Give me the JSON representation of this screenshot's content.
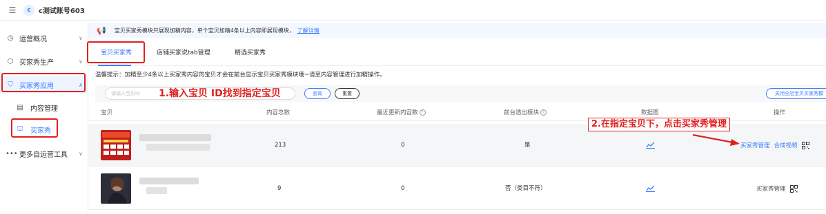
{
  "header": {
    "menu_icon": "menu-icon",
    "avatar_letter": "c",
    "account_name": "c测试账号603"
  },
  "sidebar": {
    "items": [
      {
        "icon": "clock-icon",
        "label": "运营概况",
        "chevron": "chevron-down-icon"
      },
      {
        "icon": "box-icon",
        "label": "买家秀生产",
        "chevron": "chevron-down-icon"
      },
      {
        "icon": "bag-icon",
        "label": "买家秀应用",
        "chevron": "chevron-up-icon"
      },
      {
        "icon": "document-icon",
        "label": "内容管理"
      },
      {
        "icon": "shop-icon",
        "label": "买家秀"
      },
      {
        "icon": "more-icon",
        "label": "更多自运营工具",
        "chevron": "chevron-down-icon"
      }
    ]
  },
  "notice": {
    "icon": "megaphone-icon",
    "text": "宝贝买家秀模块只展现加精内容，单个宝贝加精4条以上内容即展现模块，",
    "link": "了解详情"
  },
  "tabs": [
    {
      "label": "宝贝买家秀",
      "active": true
    },
    {
      "label": "店铺买家说tab管理",
      "active": false
    },
    {
      "label": "精选买家秀",
      "active": false
    }
  ],
  "tip": "温馨提示：加精至少4条以上买家秀内容的宝贝才会在前台显示宝贝买家秀模块哦~请至内容管理进行加精操作。",
  "filter": {
    "search_placeholder": "请输入宝贝id",
    "query_label": "查询",
    "reset_label": "重置",
    "close_all_label": "关闭全店宝贝买家秀模"
  },
  "annotations": {
    "step1": "1.输入宝贝 ID找到指定宝贝",
    "step2": "2.在指定宝贝下，点击买家秀管理"
  },
  "table": {
    "columns": [
      "宝贝",
      "内容总数",
      "最近更新内容数",
      "前台透出模块",
      "数据图",
      "操作"
    ],
    "rows": [
      {
        "total": "213",
        "recent": "0",
        "shown": "是",
        "chart_icon": "line-chart-icon",
        "actions": [
          "买家秀管理",
          "合成视频"
        ],
        "qr_icon": "qrcode-icon"
      },
      {
        "total": "9",
        "recent": "0",
        "shown": "否（类目不符）",
        "chart_icon": "line-chart-icon",
        "actions": [
          "买家秀管理"
        ],
        "qr_icon": "qrcode-icon"
      }
    ]
  },
  "colors": {
    "accent": "#3b7cff",
    "annotation_red": "#e02020"
  }
}
